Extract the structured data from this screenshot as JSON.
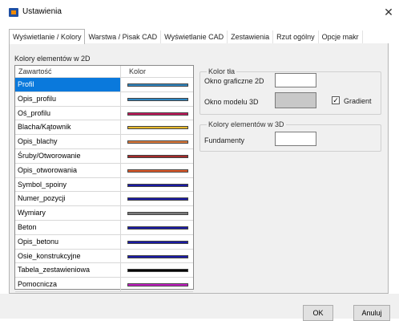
{
  "window": {
    "title": "Ustawienia",
    "close_glyph": "✕"
  },
  "tabs": [
    {
      "label": "Wyświetlanie / Kolory",
      "active": true
    },
    {
      "label": "Warstwa / Pisak CAD",
      "active": false
    },
    {
      "label": "Wyświetlanie CAD",
      "active": false
    },
    {
      "label": "Zestawienia",
      "active": false
    },
    {
      "label": "Rzut ogólny",
      "active": false
    },
    {
      "label": "Opcje makr",
      "active": false
    }
  ],
  "elements_2d": {
    "caption": "Kolory elementów w 2D",
    "col_content": "Zawartość",
    "col_color": "Kolor",
    "rows": [
      {
        "name": "Profil",
        "color": "#2e86c1",
        "selected": true
      },
      {
        "name": "Opis_profilu",
        "color": "#2e86c1",
        "selected": false
      },
      {
        "name": "Oś_profilu",
        "color": "#c2185b",
        "selected": false
      },
      {
        "name": "Blacha/Kątownik",
        "color": "#e8b92e",
        "selected": false
      },
      {
        "name": "Opis_blachy",
        "color": "#e07a3a",
        "selected": false
      },
      {
        "name": "Śruby/Otworowanie",
        "color": "#a52a2a",
        "selected": false
      },
      {
        "name": "Opis_otworowania",
        "color": "#e05a2a",
        "selected": false
      },
      {
        "name": "Symbol_spoiny",
        "color": "#1a1aa6",
        "selected": false
      },
      {
        "name": "Numer_pozycji",
        "color": "#1a1aa6",
        "selected": false
      },
      {
        "name": "Wymiary",
        "color": "#7a7a7a",
        "selected": false
      },
      {
        "name": "Beton",
        "color": "#1a1aa6",
        "selected": false
      },
      {
        "name": "Opis_betonu",
        "color": "#1a1aa6",
        "selected": false
      },
      {
        "name": "Osie_konstrukcyjne",
        "color": "#1a1aa6",
        "selected": false
      },
      {
        "name": "Tabela_zestawieniowa",
        "color": "#000000",
        "selected": false
      },
      {
        "name": "Pomocnicza",
        "color": "#c21fc2",
        "selected": false
      }
    ]
  },
  "background": {
    "group_title": "Kolor tła",
    "label_2d": "Okno graficzne 2D",
    "color_2d": "#ffffff",
    "label_3d": "Okno modelu 3D",
    "color_3d": "#c8c8c8",
    "gradient_label": "Gradient",
    "gradient_checked": true
  },
  "elements_3d": {
    "group_title": "Kolory elementów w 3D",
    "foundations_label": "Fundamenty",
    "foundations_color": "#ffffff"
  },
  "buttons": {
    "ok": "OK",
    "cancel": "Anuluj"
  }
}
